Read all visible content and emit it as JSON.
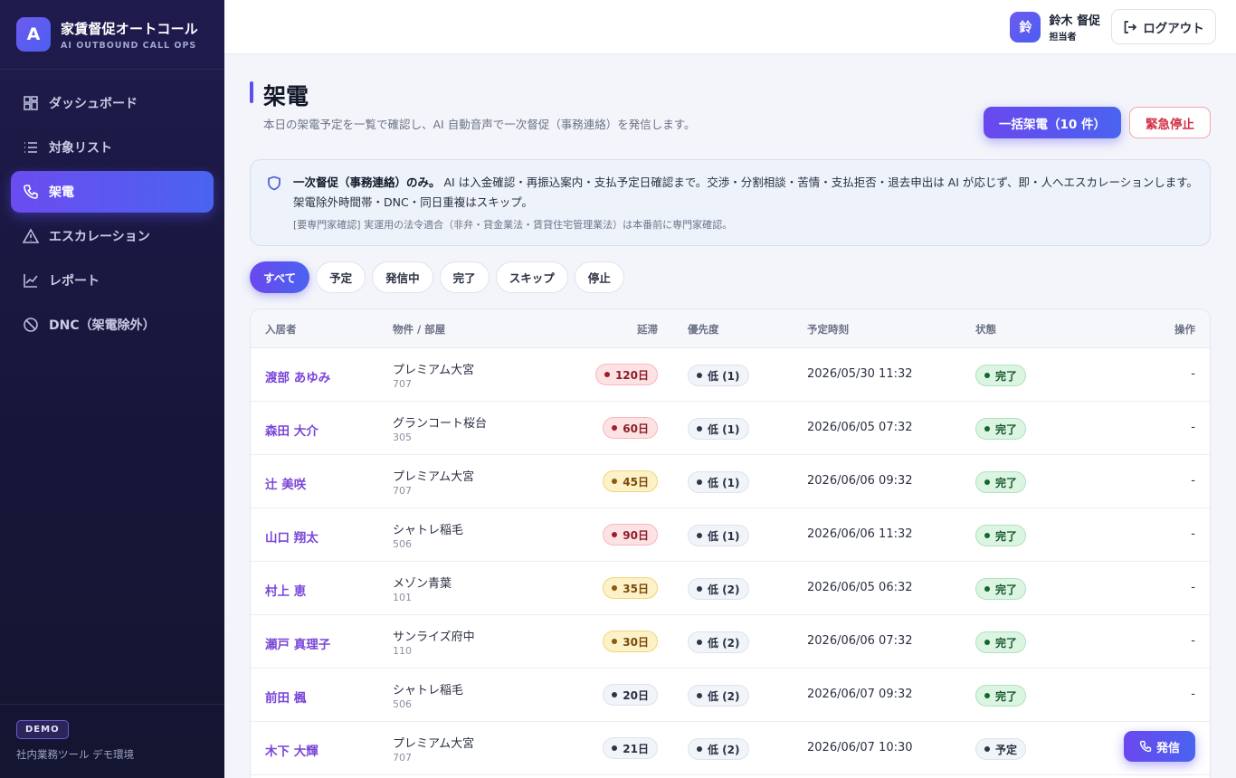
{
  "brand": {
    "logo_letter": "A",
    "title": "家賃督促オートコール",
    "subtitle": "AI OUTBOUND CALL OPS"
  },
  "sidebar": {
    "items": [
      {
        "label": "ダッシュボード",
        "icon": "dashboard-icon"
      },
      {
        "label": "対象リスト",
        "icon": "list-icon"
      },
      {
        "label": "架電",
        "icon": "phone-icon",
        "active": true
      },
      {
        "label": "エスカレーション",
        "icon": "warning-icon"
      },
      {
        "label": "レポート",
        "icon": "chart-icon"
      },
      {
        "label": "DNC（架電除外）",
        "icon": "ban-icon"
      }
    ],
    "footer_badge": "DEMO",
    "footer_text": "社内業務ツール デモ環境"
  },
  "topbar": {
    "avatar_text": "鈴",
    "user_name": "鈴木 督促",
    "user_role": "担当者",
    "logout_label": "ログアウト"
  },
  "page": {
    "title": "架電",
    "subtitle": "本日の架電予定を一覧で確認し、AI 自動音声で一次督促（事務連絡）を発信します。",
    "bulk_button": "一括架電（10 件）",
    "stop_button": "緊急停止"
  },
  "notice": {
    "lead": "一次督促（事務連絡）のみ。",
    "body": " AI は入金確認・再振込案内・支払予定日確認まで。交渉・分割相談・苦情・支払拒否・退去申出は AI が応じず、即・人へエスカレーションします。 架電除外時間帯・DNC・同日重複はスキップ。",
    "small": "[要専門家確認] 実運用の法令適合（非弁・貸金業法・賃貸住宅管理業法）は本番前に専門家確認。"
  },
  "filters": [
    "すべて",
    "予定",
    "発信中",
    "完了",
    "スキップ",
    "停止"
  ],
  "active_filter": "すべて",
  "table": {
    "headers": {
      "name": "入居者",
      "property": "物件 / 部屋",
      "delay": "延滞",
      "priority": "優先度",
      "time": "予定時刻",
      "status": "状態",
      "action": "操作"
    },
    "rows": [
      {
        "name": "渡部 あゆみ",
        "property": "プレミアム大宮",
        "room": "707",
        "delay": "120日",
        "delay_level": "red",
        "priority": "低 (1)",
        "time": "2026/05/30 11:32",
        "status": "完了",
        "status_level": "green",
        "action": "-"
      },
      {
        "name": "森田 大介",
        "property": "グランコート桜台",
        "room": "305",
        "delay": "60日",
        "delay_level": "red",
        "priority": "低 (1)",
        "time": "2026/06/05 07:32",
        "status": "完了",
        "status_level": "green",
        "action": "-"
      },
      {
        "name": "辻 美咲",
        "property": "プレミアム大宮",
        "room": "707",
        "delay": "45日",
        "delay_level": "amber",
        "priority": "低 (1)",
        "time": "2026/06/06 09:32",
        "status": "完了",
        "status_level": "green",
        "action": "-"
      },
      {
        "name": "山口 翔太",
        "property": "シャトレ稲毛",
        "room": "506",
        "delay": "90日",
        "delay_level": "red",
        "priority": "低 (1)",
        "time": "2026/06/06 11:32",
        "status": "完了",
        "status_level": "green",
        "action": "-"
      },
      {
        "name": "村上 恵",
        "property": "メゾン青葉",
        "room": "101",
        "delay": "35日",
        "delay_level": "amber",
        "priority": "低 (2)",
        "time": "2026/06/05 06:32",
        "status": "完了",
        "status_level": "green",
        "action": "-"
      },
      {
        "name": "瀬戸 真理子",
        "property": "サンライズ府中",
        "room": "110",
        "delay": "30日",
        "delay_level": "amber",
        "priority": "低 (2)",
        "time": "2026/06/06 07:32",
        "status": "完了",
        "status_level": "green",
        "action": "-"
      },
      {
        "name": "前田 楓",
        "property": "シャトレ稲毛",
        "room": "506",
        "delay": "20日",
        "delay_level": "gray",
        "priority": "低 (2)",
        "time": "2026/06/07 09:32",
        "status": "完了",
        "status_level": "green",
        "action": "-"
      },
      {
        "name": "木下 大輝",
        "property": "プレミアム大宮",
        "room": "707",
        "delay": "21日",
        "delay_level": "gray",
        "priority": "低 (2)",
        "time": "2026/06/07 10:30",
        "status": "予定",
        "status_level": "gray",
        "action": ""
      }
    ]
  },
  "fab_label": "発信"
}
